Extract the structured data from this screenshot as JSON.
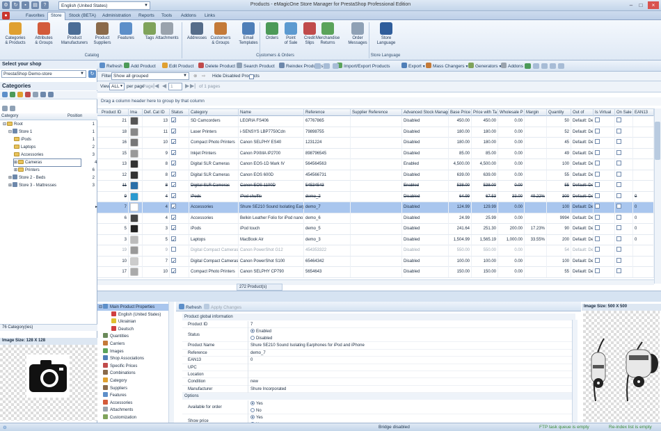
{
  "window": {
    "title": "Products - eMagicOne Store Manager for PrestaShop Professional Edition",
    "language": "English (United States)"
  },
  "menu": [
    "Favorites",
    "Store",
    "Stock (BETA)",
    "Administration",
    "Reports",
    "Tools",
    "Addons",
    "Links"
  ],
  "menu_active": "Store",
  "ribbon": {
    "buttons": [
      {
        "label": "Categories\n& Products",
        "color": "#e0a030"
      },
      {
        "label": "Attributes\n& Groups",
        "color": "#d35b3a"
      },
      {
        "label": "Product\nManufacturers",
        "color": "#4b6d96"
      },
      {
        "label": "Product\nSuppliers",
        "color": "#8a6a4a"
      },
      {
        "label": "Features",
        "color": "#5d8fc9"
      },
      {
        "label": "Tags",
        "color": "#7fa35b"
      },
      {
        "label": "Attachments",
        "color": "#9aa3ad"
      },
      {
        "label": "Addresses",
        "color": "#566d8a"
      },
      {
        "label": "Customers\n& Groups",
        "color": "#c47a38"
      },
      {
        "label": "Email\nTemplates",
        "color": "#4f7fb8"
      },
      {
        "label": "Orders",
        "color": "#4c9a58"
      },
      {
        "label": "Point\nof Sale",
        "color": "#5c9ad0"
      },
      {
        "label": "Credit\nSlips",
        "color": "#c04b4b"
      },
      {
        "label": "Merchandise\nReturns",
        "color": "#5aa35a"
      },
      {
        "label": "Order\nMessages",
        "color": "#8fa1b5"
      },
      {
        "label": "Store\nLanguage",
        "color": "#2f5d9b"
      }
    ],
    "groups": [
      "Catalog",
      "Customers & Orders",
      "Store Language"
    ]
  },
  "toolbar": [
    "Refresh",
    "Add Product",
    "Edit Product",
    "Delete Product",
    "Search Product",
    "Reindex Product(s)",
    "Import/Export Products",
    "Export",
    "Mass Changers",
    "Generators",
    "Addons"
  ],
  "filter": {
    "label": "Filter",
    "value": "Show all grouped",
    "hide_disabled": "Hide Disabled Products"
  },
  "pager": {
    "view_label": "View",
    "view_value": "ALL",
    "per_page": "per page",
    "page_label": "Page",
    "page_value": "1",
    "of_pages": "of 1 pages"
  },
  "left": {
    "select_shop": "Select your shop",
    "shop_value": "PrestaShop Demo-store",
    "categories_title": "Categories",
    "col_category": "Category",
    "col_position": "Position",
    "tree": [
      {
        "name": "Root",
        "pos": "1",
        "depth": 0,
        "type": "folder"
      },
      {
        "name": "Store 1",
        "pos": "1",
        "depth": 1,
        "type": "store"
      },
      {
        "name": "iPods",
        "pos": "1",
        "depth": 2,
        "type": "folder"
      },
      {
        "name": "Laptops",
        "pos": "2",
        "depth": 2,
        "type": "folder"
      },
      {
        "name": "Accessories",
        "pos": "3",
        "depth": 2,
        "type": "folder"
      },
      {
        "name": "Cameras",
        "pos": "4",
        "depth": 2,
        "type": "folder",
        "selected": true
      },
      {
        "name": "Printers",
        "pos": "6",
        "depth": 2,
        "type": "folder"
      },
      {
        "name": "Store 2 - Beds",
        "pos": "2",
        "depth": 1,
        "type": "store"
      },
      {
        "name": "Store 3 - Mattresses",
        "pos": "3",
        "depth": 1,
        "type": "store"
      }
    ],
    "count": "76 Category(ies)",
    "image_size": "Image Size: 128 X 128"
  },
  "grid": {
    "group_hint": "Drag a column header here to group by that column",
    "columns": [
      "Product ID",
      "Ima",
      "Def. Cat ID",
      "Status",
      "Category",
      "Name",
      "Reference",
      "Supplier Reference",
      "Advanced Stock Manage",
      "Base Price",
      "Price with Ta",
      "Wholesale P",
      "Margin",
      "Quantity",
      "Out of",
      "Is Virtual",
      "On Sale",
      "EAN13"
    ],
    "rows": [
      {
        "id": "21",
        "cat_id": "13",
        "status": true,
        "category": "SD Camcorders",
        "name": "LEGRIA FS406",
        "ref": "67767865",
        "asm": "Disabled",
        "base": "450.00",
        "tax": "450.00",
        "whole": "0.00",
        "margin": "",
        "qty": "50",
        "out": "Default: De",
        "ean": "",
        "thumb": "#555"
      },
      {
        "id": "18",
        "cat_id": "11",
        "status": true,
        "category": "Laser Printers",
        "name": "i-SENSYS LBP7750Cdn",
        "ref": "79898755",
        "asm": "Disabled",
        "base": "180.00",
        "tax": "180.00",
        "whole": "0.00",
        "margin": "",
        "qty": "52",
        "out": "Default: De",
        "ean": "",
        "thumb": "#888"
      },
      {
        "id": "16",
        "cat_id": "10",
        "status": true,
        "category": "Compact Photo Printers",
        "name": "Canon SELPHY ES40",
        "ref": "1231224",
        "asm": "Disabled",
        "base": "180.00",
        "tax": "180.00",
        "whole": "0.00",
        "margin": "",
        "qty": "45",
        "out": "Default: De",
        "ean": "",
        "thumb": "#777"
      },
      {
        "id": "15",
        "cat_id": "9",
        "status": true,
        "category": "Inkjet Printers",
        "name": "Canon PIXMA iP2700",
        "ref": "898796545",
        "asm": "Disabled",
        "base": "85.00",
        "tax": "85.00",
        "whole": "0.00",
        "margin": "",
        "qty": "49",
        "out": "Default: De",
        "ean": "",
        "thumb": "#999"
      },
      {
        "id": "13",
        "cat_id": "8",
        "status": true,
        "category": "Digital SLR Cameras",
        "name": "Canon EOS-1D Mark IV",
        "ref": "564564563",
        "asm": "Enabled",
        "base": "4,500.00",
        "tax": "4,500.00",
        "whole": "0.00",
        "margin": "",
        "qty": "100",
        "out": "Default: De",
        "ean": "",
        "thumb": "#333"
      },
      {
        "id": "12",
        "cat_id": "8",
        "status": true,
        "category": "Digital SLR Cameras",
        "name": "Canon EOS 600D",
        "ref": "454566731",
        "asm": "Disabled",
        "base": "639.00",
        "tax": "639.00",
        "whole": "0.00",
        "margin": "",
        "qty": "55",
        "out": "Default: De",
        "ean": "",
        "thumb": "#333"
      },
      {
        "id": "11",
        "cat_id": "8",
        "status": true,
        "category": "Digital SLR Cameras",
        "name": "Canon EOS 1100D",
        "ref": "54534543",
        "asm": "Enabled",
        "base": "538.00",
        "tax": "538.00",
        "whole": "0.00",
        "margin": "",
        "qty": "55",
        "out": "Default: De",
        "ean": "",
        "thumb": "#2a6fa8",
        "strike": true
      },
      {
        "id": "9",
        "cat_id": "4",
        "status": true,
        "category": "iPods",
        "name": "iPod shuffle",
        "ref": "demo_2",
        "asm": "Disabled",
        "base": "64.99",
        "tax": "67.53",
        "whole": "33.00",
        "margin": "49.22%",
        "qty": "300",
        "out": "Default: De",
        "ean": "0",
        "thumb": "#2a9ad0",
        "strike": true
      },
      {
        "id": "7",
        "cat_id": "4",
        "status": true,
        "category": "Accessories",
        "name": "Shure SE210 Sound Isolating Earpho",
        "ref": "demo_7",
        "asm": "Disabled",
        "base": "124.99",
        "tax": "129.99",
        "whole": "0.00",
        "margin": "",
        "qty": "100",
        "out": "Default: De",
        "ean": "0",
        "thumb": "#fff",
        "selected": true
      },
      {
        "id": "6",
        "cat_id": "4",
        "status": true,
        "category": "Accessories",
        "name": "Belkin Leather Folio for iPod nano - B",
        "ref": "demo_6",
        "asm": "Disabled",
        "base": "24.99",
        "tax": "25.99",
        "whole": "0.00",
        "margin": "",
        "qty": "9994",
        "out": "Default: De",
        "ean": "0",
        "thumb": "#444"
      },
      {
        "id": "5",
        "cat_id": "3",
        "status": true,
        "category": "iPods",
        "name": "iPod touch",
        "ref": "demo_5",
        "asm": "Disabled",
        "base": "241.64",
        "tax": "251.30",
        "whole": "200.00",
        "margin": "17.23%",
        "qty": "90",
        "out": "Default: De",
        "ean": "0",
        "thumb": "#222"
      },
      {
        "id": "3",
        "cat_id": "5",
        "status": true,
        "category": "Laptops",
        "name": "MacBook Air",
        "ref": "demo_3",
        "asm": "Disabled",
        "base": "1,504.99",
        "tax": "1,565.19",
        "whole": "1,000.00",
        "margin": "33.55%",
        "qty": "200",
        "out": "Default: De",
        "ean": "0",
        "thumb": "#bbb"
      },
      {
        "id": "19",
        "cat_id": "9",
        "status": false,
        "category": "Digital Compact Cameras",
        "name": "Canon PowerShot G12",
        "ref": "454353322",
        "asm": "Disabled",
        "base": "550.00",
        "tax": "550.00",
        "whole": "0.00",
        "margin": "",
        "qty": "54",
        "out": "Default: De",
        "ean": "",
        "thumb": "#999",
        "disabled": true
      },
      {
        "id": "10",
        "cat_id": "7",
        "status": true,
        "category": "Digital Compact Cameras",
        "name": "Canon PowerShot S100",
        "ref": "65464342",
        "asm": "Disabled",
        "base": "100.00",
        "tax": "100.00",
        "whole": "0.00",
        "margin": "",
        "qty": "100",
        "out": "Default: De",
        "ean": "",
        "thumb": "#ccc"
      },
      {
        "id": "17",
        "cat_id": "10",
        "status": true,
        "category": "Compact Photo Printers",
        "name": "Canon SELPHY CP790",
        "ref": "5654643",
        "asm": "Disabled",
        "base": "150.00",
        "tax": "150.00",
        "whole": "0.00",
        "margin": "",
        "qty": "55",
        "out": "Default: De",
        "ean": "",
        "thumb": "#aaa"
      }
    ],
    "footer": "272 Product(s)"
  },
  "props": {
    "tree": [
      {
        "label": "Main Product Properties",
        "icon": "#5d8fc9",
        "selected": true
      },
      {
        "label": "English (United States)",
        "icon": "#d04040",
        "indent": true
      },
      {
        "label": "Ukrainian",
        "icon": "#e0c030",
        "indent": true
      },
      {
        "label": "Deutsch",
        "icon": "#d04040",
        "indent": true
      },
      {
        "label": "Quantities",
        "icon": "#6a8a5a"
      },
      {
        "label": "Carriers",
        "icon": "#c47a38"
      },
      {
        "label": "Images",
        "icon": "#5aa35a"
      },
      {
        "label": "Shop Associations",
        "icon": "#4f7fb8"
      },
      {
        "label": "Specific Prices",
        "icon": "#c04b4b"
      },
      {
        "label": "Combinations",
        "icon": "#8a6a4a"
      },
      {
        "label": "Category",
        "icon": "#e0a030"
      },
      {
        "label": "Suppliers",
        "icon": "#8a6a4a"
      },
      {
        "label": "Features",
        "icon": "#5d8fc9"
      },
      {
        "label": "Accessories",
        "icon": "#d35b3a"
      },
      {
        "label": "Attachments",
        "icon": "#9aa3ad"
      },
      {
        "label": "Customization",
        "icon": "#7fa35b"
      }
    ],
    "toolbar": {
      "refresh": "Refresh",
      "apply": "Apply Changes"
    },
    "section_global": "Product global information",
    "fields": [
      {
        "k": "Product ID",
        "v": "7"
      },
      {
        "k": "Status",
        "radio": [
          "Enabled",
          "Disabled"
        ],
        "on": 0
      },
      {
        "k": "Product Name",
        "v": "Shure SE210 Sound Isolating Earphones for iPod and iPhone"
      },
      {
        "k": "Reference",
        "v": "demo_7"
      },
      {
        "k": "EAN13",
        "v": "0"
      },
      {
        "k": "UPC",
        "v": ""
      },
      {
        "k": "Location",
        "v": ""
      },
      {
        "k": "Condition",
        "v": "new"
      },
      {
        "k": "Manufacturer",
        "v": "Shure Incorporated"
      }
    ],
    "section_options": "Options",
    "options": [
      {
        "k": "Available for order",
        "radio": [
          "Yes",
          "No"
        ],
        "on": 0
      },
      {
        "k": "Show price",
        "radio": [
          "Yes",
          "No"
        ],
        "on": 0
      }
    ],
    "image_size": "Image Size: 500 X 500"
  },
  "status": {
    "bridge": "Bridge disabled",
    "ftp": "FTP task queue is empty",
    "reindex": "Re-index list is empty"
  }
}
